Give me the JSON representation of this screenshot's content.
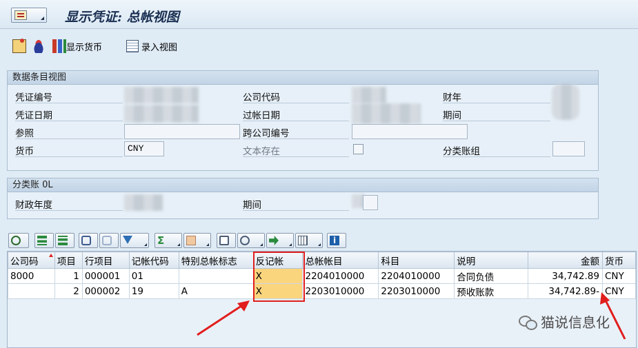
{
  "window": {
    "title": "显示凭证: 总帐视图"
  },
  "toolbar": {
    "show_currency": "显示货币",
    "entry_view": "录入视图"
  },
  "header_group": {
    "title": "数据条目视图",
    "labels": {
      "doc_no": "凭证编号",
      "company_code": "公司代码",
      "fiscal_year": "财年",
      "doc_date": "凭证日期",
      "posting_date": "过帐日期",
      "period": "期间",
      "reference": "参照",
      "cross_cc": "跨公司编号",
      "currency": "货币",
      "text_exists": "文本存在",
      "ledger_group": "分类账组"
    },
    "values": {
      "currency": "CNY"
    }
  },
  "ledger_group": {
    "title": "分类账 0L",
    "labels": {
      "fiscal_year": "财政年度",
      "period": "期间"
    }
  },
  "table": {
    "columns": [
      "公司码",
      "项目",
      "行项目",
      "记帐代码",
      "特别总帐标志",
      "反记帐",
      "总帐帐目",
      "科目",
      "说明",
      "金额",
      "货币"
    ],
    "rows": [
      {
        "cc": "8000",
        "item": "1",
        "line": "000001",
        "pk": "01",
        "sgl": "",
        "reverse": "X",
        "gl": "2204010000",
        "acct": "2204010000",
        "desc": "合同负债",
        "amount": "34,742.89",
        "cur": "CNY"
      },
      {
        "cc": "",
        "item": "2",
        "line": "000002",
        "pk": "19",
        "sgl": "A",
        "reverse": "X",
        "gl": "2203010000",
        "acct": "2203010000",
        "desc": "预收账款",
        "amount": "34,742.89-",
        "cur": "CNY"
      }
    ]
  },
  "watermark": {
    "text": "猫说信息化"
  },
  "colors": {
    "accent_red": "#e11d1d",
    "highlight": "#fbd57e"
  }
}
